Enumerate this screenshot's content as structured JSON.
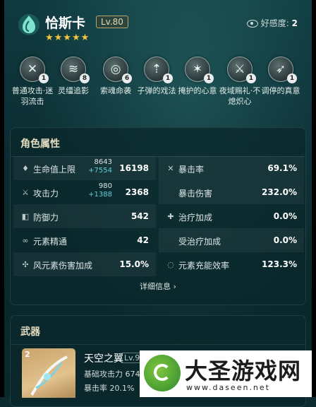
{
  "character": {
    "name": "恰斯卡",
    "level": "Lv.80",
    "stars": "★★★★★",
    "favor_label": "好感度:",
    "favor_value": "2"
  },
  "talents": [
    {
      "name": "普通攻击·迷羽流击",
      "level": "1",
      "icon": "crossbow-icon"
    },
    {
      "name": "灵缰追影",
      "level": "8",
      "icon": "wind-whip-icon"
    },
    {
      "name": "索魂命袭",
      "level": "6",
      "icon": "swirl-icon"
    },
    {
      "name": "子弹的戏法",
      "level": "1",
      "icon": "bullet-icon"
    },
    {
      "name": "掩护的心意",
      "level": "1",
      "icon": "shield-cover-icon"
    },
    {
      "name": "夜域赐礼·不熄炽心",
      "level": "1",
      "icon": "flame-icon"
    },
    {
      "name": "调停的真意",
      "level": "1",
      "icon": "arrow-icon"
    }
  ],
  "attributes": {
    "title": "角色属性",
    "more": "详细信息",
    "left": [
      {
        "label": "生命值上限",
        "base": "8643",
        "bonus": "+7554",
        "value": "16198",
        "icon": "hp-icon"
      },
      {
        "label": "攻击力",
        "base": "980",
        "bonus": "+1388",
        "value": "2368",
        "icon": "sword-icon"
      },
      {
        "label": "防御力",
        "value": "542",
        "icon": "shield-icon"
      },
      {
        "label": "元素精通",
        "value": "42",
        "icon": "mastery-icon"
      },
      {
        "label": "风元素伤害加成",
        "value": "15.0%",
        "icon": "anemo-icon"
      }
    ],
    "right": [
      {
        "label": "暴击率",
        "value": "69.1%",
        "icon": "crit-icon"
      },
      {
        "label": "暴击伤害",
        "value": "232.0%",
        "icon": ""
      },
      {
        "label": "治疗加成",
        "value": "0.0%",
        "icon": "plus-icon"
      },
      {
        "label": "受治疗加成",
        "value": "0.0%",
        "icon": ""
      },
      {
        "label": "元素充能效率",
        "value": "123.3%",
        "icon": "recharge-icon"
      }
    ]
  },
  "weapon": {
    "title": "武器",
    "refinement": "2",
    "name": "天空之翼",
    "level": "Lv.90",
    "atk": "基础攻击力 674",
    "crit": "暴击率 20.1%"
  },
  "watermark": {
    "title": "大圣游戏网",
    "url": "www.daseen.net"
  }
}
